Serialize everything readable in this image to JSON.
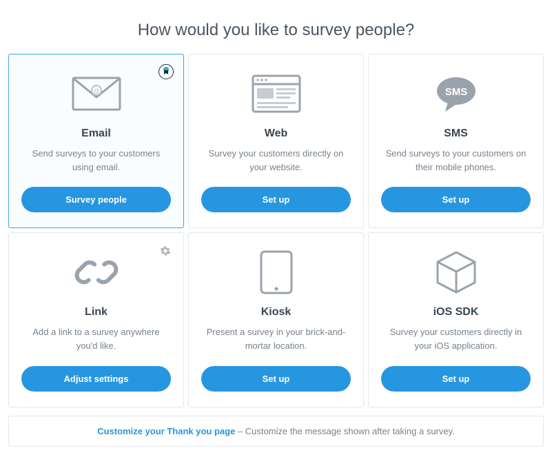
{
  "heading": "How would you like to survey people?",
  "colors": {
    "accent": "#2796e0",
    "cardBorder": "#e3e6e9",
    "selectedBorder": "#3ca6d8",
    "iconGray": "#9aa3ab",
    "textDark": "#3b4550",
    "textMuted": "#77828d"
  },
  "cards": [
    {
      "id": "email",
      "iconName": "envelope-icon",
      "title": "Email",
      "desc": "Send surveys to your customers using email.",
      "cta": "Survey people",
      "selected": true,
      "topIcon": "badge-icon"
    },
    {
      "id": "web",
      "iconName": "browser-icon",
      "title": "Web",
      "desc": "Survey your customers directly on your website.",
      "cta": "Set up",
      "selected": false,
      "topIcon": null
    },
    {
      "id": "sms",
      "iconName": "sms-icon",
      "title": "SMS",
      "desc": "Send surveys to your customers on their mobile phones.",
      "cta": "Set up",
      "selected": false,
      "topIcon": null
    },
    {
      "id": "link",
      "iconName": "link-icon",
      "title": "Link",
      "desc": "Add a link to a survey anywhere you'd like.",
      "cta": "Adjust settings",
      "selected": false,
      "topIcon": "gear-icon"
    },
    {
      "id": "kiosk",
      "iconName": "tablet-icon",
      "title": "Kiosk",
      "desc": "Present a survey in your brick-and-mortar location.",
      "cta": "Set up",
      "selected": false,
      "topIcon": null
    },
    {
      "id": "iossdk",
      "iconName": "cube-icon",
      "title": "iOS SDK",
      "desc": "Survey your customers directly in your iOS application.",
      "cta": "Set up",
      "selected": false,
      "topIcon": null
    }
  ],
  "smsBubbleText": "SMS",
  "footer": {
    "linkText": "Customize your Thank you page",
    "separator": " – ",
    "rest": "Customize the message shown after taking a survey."
  }
}
